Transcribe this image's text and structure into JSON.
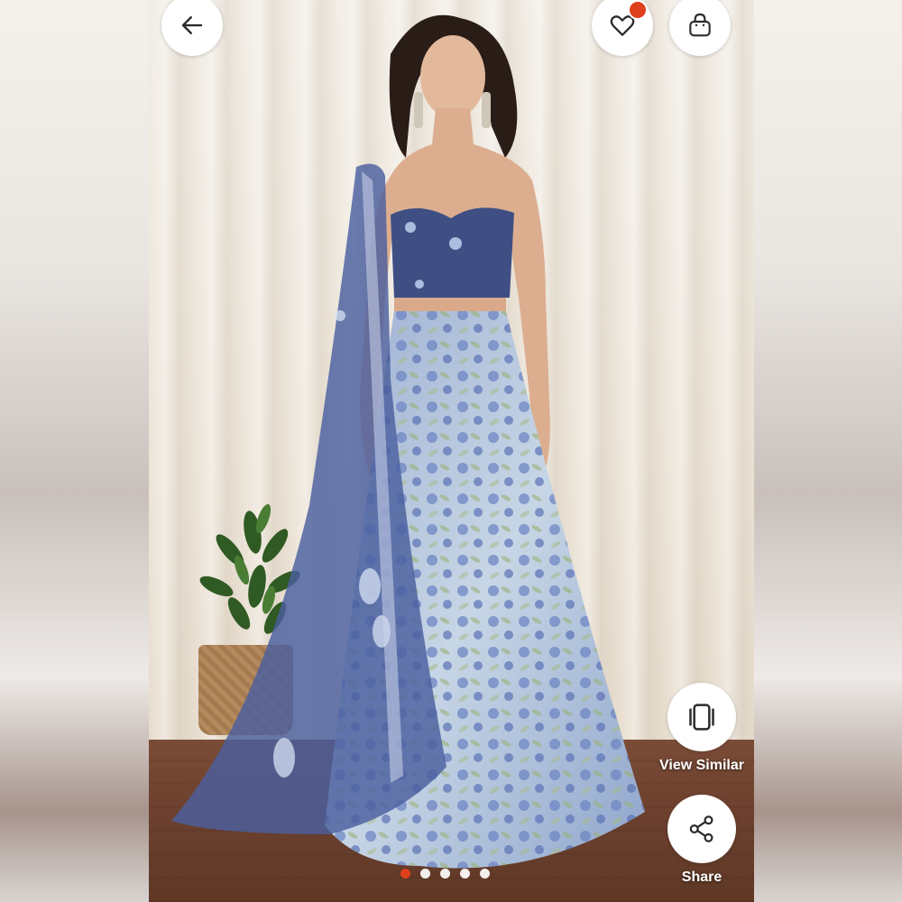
{
  "product_image": {
    "alt": "",
    "image_count": 5,
    "active_index": 0
  },
  "header": {
    "back_icon": "arrow-left-icon",
    "wishlist_icon": "heart-icon",
    "wishlist_badge_color": "#e0401d",
    "bag_icon": "shopping-bag-icon"
  },
  "actions": {
    "view_similar_label": "View Similar",
    "view_similar_icon": "view-similar-icon",
    "share_label": "Share",
    "share_icon": "share-icon"
  },
  "colors": {
    "accent": "#e0401d",
    "button_bg": "#ffffff",
    "label_text": "#ffffff"
  }
}
